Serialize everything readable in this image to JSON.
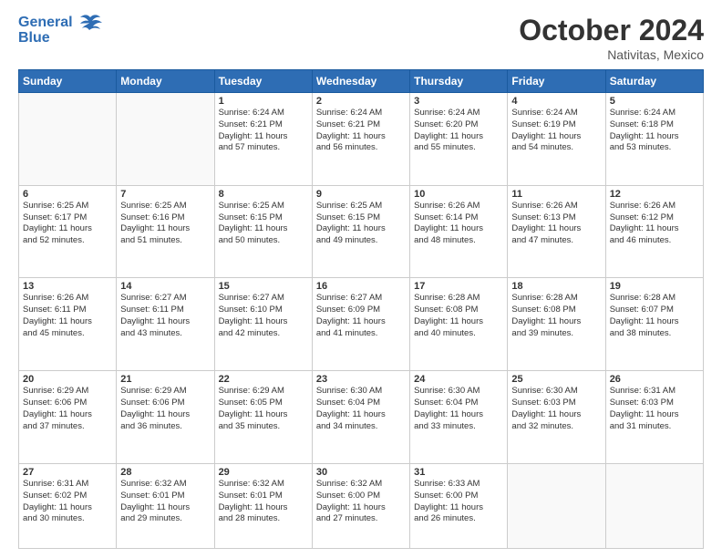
{
  "logo": {
    "line1": "General",
    "line2": "Blue"
  },
  "title": "October 2024",
  "location": "Nativitas, Mexico",
  "days_of_week": [
    "Sunday",
    "Monday",
    "Tuesday",
    "Wednesday",
    "Thursday",
    "Friday",
    "Saturday"
  ],
  "weeks": [
    [
      {
        "day": "",
        "info": ""
      },
      {
        "day": "",
        "info": ""
      },
      {
        "day": "1",
        "info": "Sunrise: 6:24 AM\nSunset: 6:21 PM\nDaylight: 11 hours\nand 57 minutes."
      },
      {
        "day": "2",
        "info": "Sunrise: 6:24 AM\nSunset: 6:21 PM\nDaylight: 11 hours\nand 56 minutes."
      },
      {
        "day": "3",
        "info": "Sunrise: 6:24 AM\nSunset: 6:20 PM\nDaylight: 11 hours\nand 55 minutes."
      },
      {
        "day": "4",
        "info": "Sunrise: 6:24 AM\nSunset: 6:19 PM\nDaylight: 11 hours\nand 54 minutes."
      },
      {
        "day": "5",
        "info": "Sunrise: 6:24 AM\nSunset: 6:18 PM\nDaylight: 11 hours\nand 53 minutes."
      }
    ],
    [
      {
        "day": "6",
        "info": "Sunrise: 6:25 AM\nSunset: 6:17 PM\nDaylight: 11 hours\nand 52 minutes."
      },
      {
        "day": "7",
        "info": "Sunrise: 6:25 AM\nSunset: 6:16 PM\nDaylight: 11 hours\nand 51 minutes."
      },
      {
        "day": "8",
        "info": "Sunrise: 6:25 AM\nSunset: 6:15 PM\nDaylight: 11 hours\nand 50 minutes."
      },
      {
        "day": "9",
        "info": "Sunrise: 6:25 AM\nSunset: 6:15 PM\nDaylight: 11 hours\nand 49 minutes."
      },
      {
        "day": "10",
        "info": "Sunrise: 6:26 AM\nSunset: 6:14 PM\nDaylight: 11 hours\nand 48 minutes."
      },
      {
        "day": "11",
        "info": "Sunrise: 6:26 AM\nSunset: 6:13 PM\nDaylight: 11 hours\nand 47 minutes."
      },
      {
        "day": "12",
        "info": "Sunrise: 6:26 AM\nSunset: 6:12 PM\nDaylight: 11 hours\nand 46 minutes."
      }
    ],
    [
      {
        "day": "13",
        "info": "Sunrise: 6:26 AM\nSunset: 6:11 PM\nDaylight: 11 hours\nand 45 minutes."
      },
      {
        "day": "14",
        "info": "Sunrise: 6:27 AM\nSunset: 6:11 PM\nDaylight: 11 hours\nand 43 minutes."
      },
      {
        "day": "15",
        "info": "Sunrise: 6:27 AM\nSunset: 6:10 PM\nDaylight: 11 hours\nand 42 minutes."
      },
      {
        "day": "16",
        "info": "Sunrise: 6:27 AM\nSunset: 6:09 PM\nDaylight: 11 hours\nand 41 minutes."
      },
      {
        "day": "17",
        "info": "Sunrise: 6:28 AM\nSunset: 6:08 PM\nDaylight: 11 hours\nand 40 minutes."
      },
      {
        "day": "18",
        "info": "Sunrise: 6:28 AM\nSunset: 6:08 PM\nDaylight: 11 hours\nand 39 minutes."
      },
      {
        "day": "19",
        "info": "Sunrise: 6:28 AM\nSunset: 6:07 PM\nDaylight: 11 hours\nand 38 minutes."
      }
    ],
    [
      {
        "day": "20",
        "info": "Sunrise: 6:29 AM\nSunset: 6:06 PM\nDaylight: 11 hours\nand 37 minutes."
      },
      {
        "day": "21",
        "info": "Sunrise: 6:29 AM\nSunset: 6:06 PM\nDaylight: 11 hours\nand 36 minutes."
      },
      {
        "day": "22",
        "info": "Sunrise: 6:29 AM\nSunset: 6:05 PM\nDaylight: 11 hours\nand 35 minutes."
      },
      {
        "day": "23",
        "info": "Sunrise: 6:30 AM\nSunset: 6:04 PM\nDaylight: 11 hours\nand 34 minutes."
      },
      {
        "day": "24",
        "info": "Sunrise: 6:30 AM\nSunset: 6:04 PM\nDaylight: 11 hours\nand 33 minutes."
      },
      {
        "day": "25",
        "info": "Sunrise: 6:30 AM\nSunset: 6:03 PM\nDaylight: 11 hours\nand 32 minutes."
      },
      {
        "day": "26",
        "info": "Sunrise: 6:31 AM\nSunset: 6:03 PM\nDaylight: 11 hours\nand 31 minutes."
      }
    ],
    [
      {
        "day": "27",
        "info": "Sunrise: 6:31 AM\nSunset: 6:02 PM\nDaylight: 11 hours\nand 30 minutes."
      },
      {
        "day": "28",
        "info": "Sunrise: 6:32 AM\nSunset: 6:01 PM\nDaylight: 11 hours\nand 29 minutes."
      },
      {
        "day": "29",
        "info": "Sunrise: 6:32 AM\nSunset: 6:01 PM\nDaylight: 11 hours\nand 28 minutes."
      },
      {
        "day": "30",
        "info": "Sunrise: 6:32 AM\nSunset: 6:00 PM\nDaylight: 11 hours\nand 27 minutes."
      },
      {
        "day": "31",
        "info": "Sunrise: 6:33 AM\nSunset: 6:00 PM\nDaylight: 11 hours\nand 26 minutes."
      },
      {
        "day": "",
        "info": ""
      },
      {
        "day": "",
        "info": ""
      }
    ]
  ]
}
